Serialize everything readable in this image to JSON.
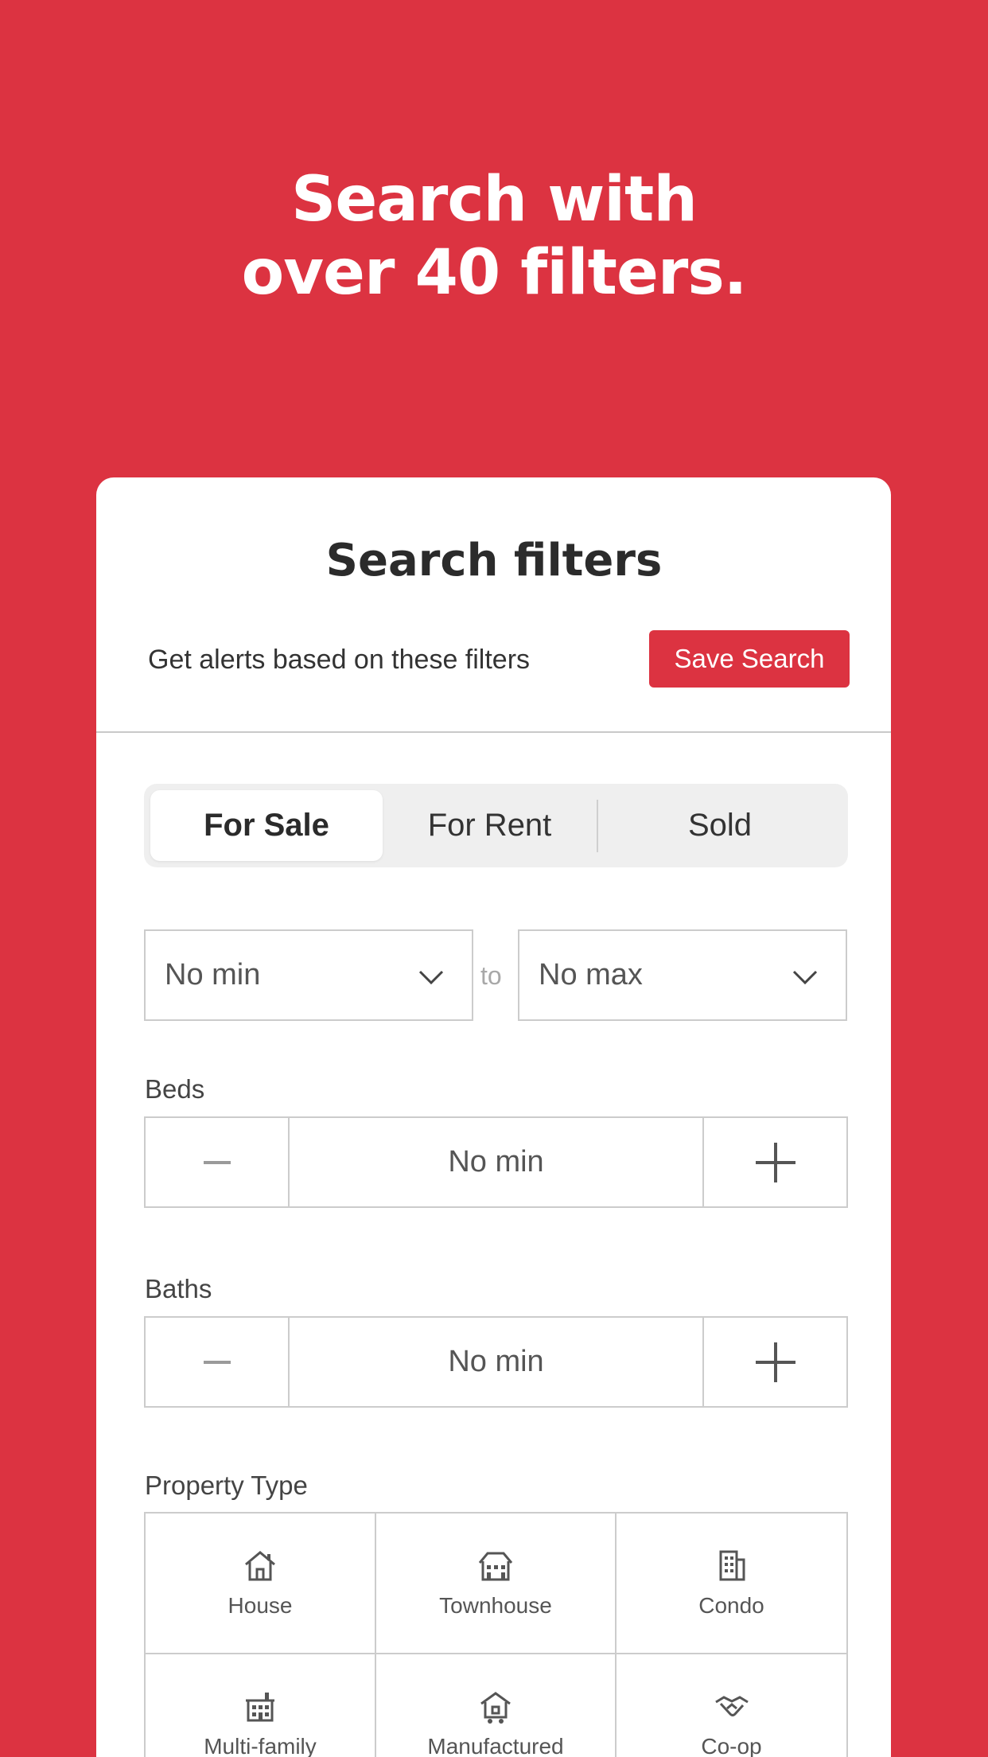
{
  "hero": {
    "line1": "Search with",
    "line2": "over 40 filters."
  },
  "card": {
    "title": "Search filters",
    "alerts_text": "Get alerts based on these filters",
    "save_button": "Save Search"
  },
  "listing_tabs": [
    {
      "label": "For Sale",
      "active": true
    },
    {
      "label": "For Rent",
      "active": false
    },
    {
      "label": "Sold",
      "active": false
    }
  ],
  "price": {
    "min_value": "No min",
    "to_label": "to",
    "max_value": "No max"
  },
  "beds": {
    "label": "Beds",
    "value": "No min"
  },
  "baths": {
    "label": "Baths",
    "value": "No min"
  },
  "property_type": {
    "label": "Property Type",
    "items": [
      {
        "label": "House",
        "icon": "house-icon"
      },
      {
        "label": "Townhouse",
        "icon": "townhouse-icon"
      },
      {
        "label": "Condo",
        "icon": "condo-icon"
      },
      {
        "label": "Multi-family",
        "icon": "multi-family-icon"
      },
      {
        "label": "Manufactured",
        "icon": "manufactured-icon"
      },
      {
        "label": "Co-op",
        "icon": "co-op-icon"
      }
    ]
  },
  "colors": {
    "brand_red": "#DC3341",
    "text_dark": "#2b2b2b",
    "border_gray": "#cccccc"
  }
}
